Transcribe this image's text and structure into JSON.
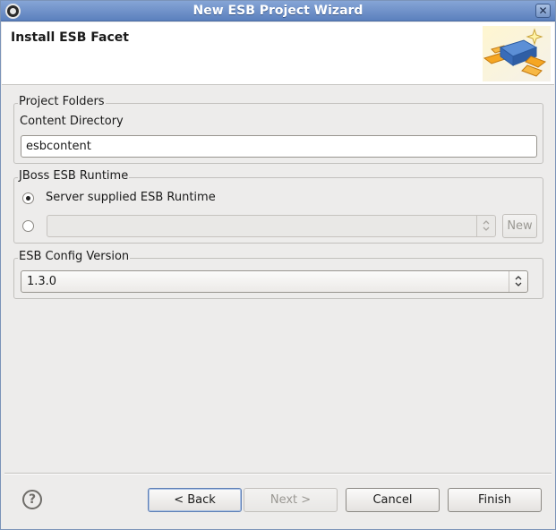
{
  "window": {
    "title": "New ESB Project Wizard"
  },
  "header": {
    "title": "Install ESB Facet"
  },
  "project_folders": {
    "group_label": "Project Folders",
    "content_dir_label": "Content Directory",
    "content_dir_value": "esbcontent"
  },
  "runtime": {
    "group_label": "JBoss ESB Runtime",
    "server_supplied_label": "Server supplied ESB Runtime",
    "server_supplied_selected": true,
    "custom_runtime_value": "",
    "new_button": "New"
  },
  "config_version": {
    "group_label": "ESB Config Version",
    "selected": "1.3.0"
  },
  "buttons": {
    "back": "< Back",
    "next": "Next >",
    "cancel": "Cancel",
    "finish": "Finish"
  },
  "icons": {
    "app": "eclipse-icon",
    "close": "close-icon",
    "help": "help-icon",
    "banner": "esb-wizard-banner-icon"
  }
}
